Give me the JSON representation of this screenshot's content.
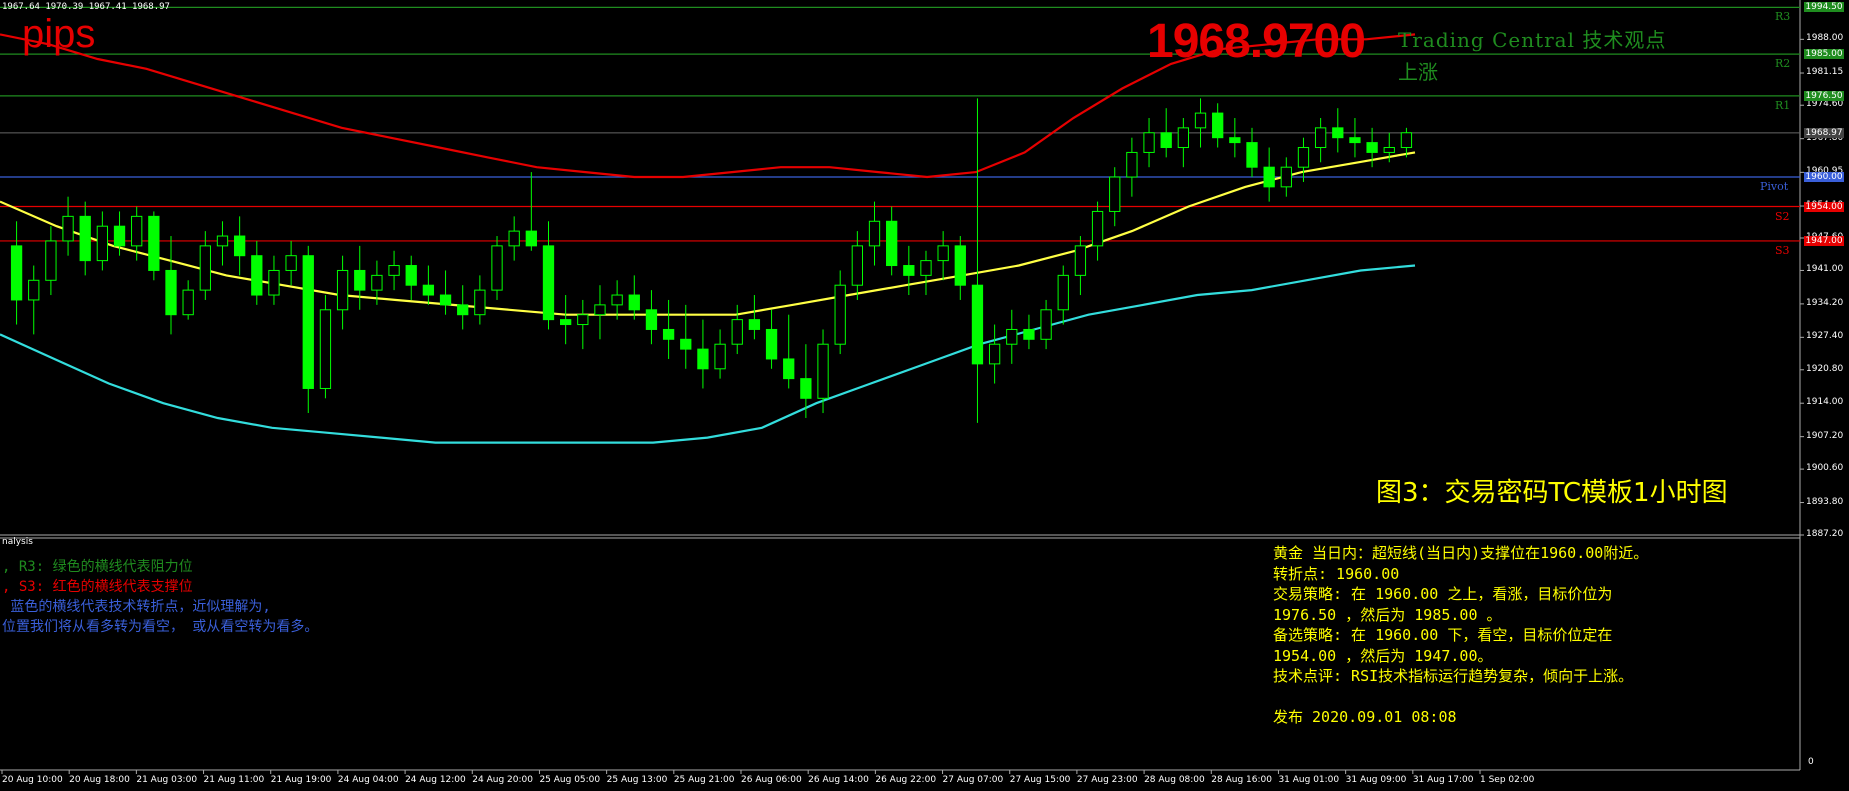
{
  "header": {
    "ohlc": "1967.64 1970.39 1967.41 1968.97",
    "watermark": "pips",
    "current_price": "1968.9700",
    "tc_title": "Trading Central 技术观点",
    "tc_direction": "上涨",
    "figure_caption": "图3：交易密码TC模板1小时图"
  },
  "levels": [
    {
      "name": "R3",
      "price": 1994.5,
      "label": "R3",
      "color": "#1f8c1f"
    },
    {
      "name": "R2",
      "price": 1985.0,
      "label": "R2",
      "color": "#1f8c1f"
    },
    {
      "name": "R1",
      "price": 1976.5,
      "label": "R1",
      "color": "#1f8c1f"
    },
    {
      "name": "Pivot",
      "price": 1960.0,
      "label": "Pivot",
      "color": "#3a5fd9"
    },
    {
      "name": "S2",
      "price": 1954.0,
      "label": "S2",
      "color": "#e60000"
    },
    {
      "name": "S3",
      "price": 1947.0,
      "label": "S3",
      "color": "#e60000"
    }
  ],
  "current_price_value": 1968.97,
  "price_axis": {
    "ticks": [
      "1988.00",
      "1981.15",
      "1974.60",
      "1967.80",
      "1960.95",
      "1954.10",
      "1947.60",
      "1941.00",
      "1934.20",
      "1927.40",
      "1920.80",
      "1914.00",
      "1907.20",
      "1900.60",
      "1893.80",
      "1887.20"
    ],
    "tags": [
      {
        "text": "1994.50",
        "color": "#1f8c1f"
      },
      {
        "text": "1985.00",
        "color": "#1f8c1f"
      },
      {
        "text": "1976.50",
        "color": "#1f8c1f"
      },
      {
        "text": "1968.97",
        "color": "#444444"
      },
      {
        "text": "1960.00",
        "color": "#3a5fd9"
      },
      {
        "text": "1954.00",
        "color": "#e60000"
      },
      {
        "text": "1947.00",
        "color": "#e60000"
      }
    ],
    "sub_zero": "0"
  },
  "time_axis": [
    "20 Aug 10:00",
    "20 Aug 18:00",
    "21 Aug 03:00",
    "21 Aug 11:00",
    "21 Aug 19:00",
    "24 Aug 04:00",
    "24 Aug 12:00",
    "24 Aug 20:00",
    "25 Aug 05:00",
    "25 Aug 13:00",
    "25 Aug 21:00",
    "26 Aug 06:00",
    "26 Aug 14:00",
    "26 Aug 22:00",
    "27 Aug 07:00",
    "27 Aug 15:00",
    "27 Aug 23:00",
    "28 Aug 08:00",
    "28 Aug 16:00",
    "31 Aug 01:00",
    "31 Aug 09:00",
    "31 Aug 17:00",
    "1 Sep 02:00"
  ],
  "subwindow": {
    "title": "nalysis",
    "legend": [
      {
        "text": ", R3: 绿色的横线代表阻力位",
        "color": "#1f8c1f"
      },
      {
        "text": ", S3: 红色的横线代表支撑位",
        "color": "#e60000"
      },
      {
        "text": " 蓝色的横线代表技术转折点，近似理解为,",
        "color": "#3a5fd9"
      },
      {
        "text": "位置我们将从看多转为看空， 或从看空转为看多。",
        "color": "#3a5fd9"
      }
    ],
    "analysis": [
      "黄金 当日内：超短线(当日内)支撑位在1960.00附近。",
      "转折点: 1960.00",
      "交易策略: 在 1960.00 之上，看涨，目标价位为",
      "1976.50 ，然后为 1985.00 。",
      "备选策略: 在 1960.00 下，看空，目标价位定在",
      "1954.00 ，然后为 1947.00。",
      "技术点评: RSI技术指标运行趋势复杂，倾向于上涨。",
      "",
      "发布 2020.09.01 08:08"
    ]
  },
  "chart_data": {
    "type": "candlestick",
    "symbol_price": 1968.97,
    "ylim": [
      1887.2,
      1996.0
    ],
    "candles": [
      [
        1946,
        1951,
        1930,
        1935
      ],
      [
        1935,
        1942,
        1928,
        1939
      ],
      [
        1939,
        1950,
        1936,
        1947
      ],
      [
        1947,
        1956,
        1944,
        1952
      ],
      [
        1952,
        1955,
        1940,
        1943
      ],
      [
        1943,
        1953,
        1941,
        1950
      ],
      [
        1950,
        1953,
        1944,
        1946
      ],
      [
        1946,
        1954,
        1943,
        1952
      ],
      [
        1952,
        1953,
        1939,
        1941
      ],
      [
        1941,
        1948,
        1928,
        1932
      ],
      [
        1932,
        1939,
        1931,
        1937
      ],
      [
        1937,
        1949,
        1935,
        1946
      ],
      [
        1946,
        1951,
        1942,
        1948
      ],
      [
        1948,
        1952,
        1940,
        1944
      ],
      [
        1944,
        1947,
        1934,
        1936
      ],
      [
        1936,
        1944,
        1934,
        1941
      ],
      [
        1941,
        1947,
        1938,
        1944
      ],
      [
        1944,
        1946,
        1912,
        1917
      ],
      [
        1917,
        1936,
        1915,
        1933
      ],
      [
        1933,
        1944,
        1929,
        1941
      ],
      [
        1941,
        1946,
        1933,
        1937
      ],
      [
        1937,
        1943,
        1934,
        1940
      ],
      [
        1940,
        1945,
        1937,
        1942
      ],
      [
        1942,
        1944,
        1935,
        1938
      ],
      [
        1938,
        1942,
        1934,
        1936
      ],
      [
        1936,
        1941,
        1932,
        1934
      ],
      [
        1934,
        1938,
        1929,
        1932
      ],
      [
        1932,
        1940,
        1930,
        1937
      ],
      [
        1937,
        1948,
        1935,
        1946
      ],
      [
        1946,
        1952,
        1943,
        1949
      ],
      [
        1949,
        1961,
        1945,
        1946
      ],
      [
        1946,
        1951,
        1929,
        1931
      ],
      [
        1931,
        1936,
        1926,
        1930
      ],
      [
        1930,
        1935,
        1925,
        1932
      ],
      [
        1932,
        1938,
        1927,
        1934
      ],
      [
        1934,
        1939,
        1931,
        1936
      ],
      [
        1936,
        1940,
        1931,
        1933
      ],
      [
        1933,
        1937,
        1926,
        1929
      ],
      [
        1929,
        1935,
        1923,
        1927
      ],
      [
        1927,
        1934,
        1921,
        1925
      ],
      [
        1925,
        1931,
        1917,
        1921
      ],
      [
        1921,
        1929,
        1919,
        1926
      ],
      [
        1926,
        1934,
        1924,
        1931
      ],
      [
        1931,
        1936,
        1927,
        1929
      ],
      [
        1929,
        1933,
        1921,
        1923
      ],
      [
        1923,
        1932,
        1917,
        1919
      ],
      [
        1919,
        1926,
        1911,
        1915
      ],
      [
        1915,
        1929,
        1912,
        1926
      ],
      [
        1926,
        1941,
        1924,
        1938
      ],
      [
        1938,
        1949,
        1935,
        1946
      ],
      [
        1946,
        1955,
        1942,
        1951
      ],
      [
        1951,
        1954,
        1940,
        1942
      ],
      [
        1942,
        1946,
        1936,
        1940
      ],
      [
        1940,
        1945,
        1936,
        1943
      ],
      [
        1943,
        1949,
        1939,
        1946
      ],
      [
        1946,
        1948,
        1935,
        1938
      ],
      [
        1938,
        1976,
        1910,
        1922
      ],
      [
        1922,
        1930,
        1918,
        1926
      ],
      [
        1926,
        1933,
        1922,
        1929
      ],
      [
        1929,
        1932,
        1925,
        1927
      ],
      [
        1927,
        1935,
        1925,
        1933
      ],
      [
        1933,
        1942,
        1930,
        1940
      ],
      [
        1940,
        1948,
        1936,
        1946
      ],
      [
        1946,
        1955,
        1943,
        1953
      ],
      [
        1953,
        1962,
        1950,
        1960
      ],
      [
        1960,
        1968,
        1956,
        1965
      ],
      [
        1965,
        1972,
        1962,
        1969
      ],
      [
        1969,
        1974,
        1964,
        1966
      ],
      [
        1966,
        1972,
        1962,
        1970
      ],
      [
        1970,
        1976,
        1966,
        1973
      ],
      [
        1973,
        1975,
        1966,
        1968
      ],
      [
        1968,
        1972,
        1964,
        1967
      ],
      [
        1967,
        1970,
        1960,
        1962
      ],
      [
        1962,
        1966,
        1955,
        1958
      ],
      [
        1958,
        1964,
        1956,
        1962
      ],
      [
        1962,
        1968,
        1959,
        1966
      ],
      [
        1966,
        1972,
        1963,
        1970
      ],
      [
        1970,
        1974,
        1965,
        1968
      ],
      [
        1968,
        1972,
        1964,
        1967
      ],
      [
        1967,
        1970,
        1962,
        1965
      ],
      [
        1965,
        1969,
        1963,
        1966
      ],
      [
        1966,
        1970,
        1964,
        1969
      ]
    ],
    "series": [
      {
        "name": "",
        "color": "#e60000",
        "values": [
          1989,
          1987,
          1984,
          1982,
          1979,
          1976,
          1973,
          1970,
          1968,
          1966,
          1964,
          1962,
          1961,
          1960,
          1960,
          1961,
          1962,
          1962,
          1961,
          1960,
          1961,
          1965,
          1972,
          1978,
          1983,
          1986,
          1987,
          1988,
          1988,
          1989
        ]
      },
      {
        "name": "",
        "color": "#ffff44",
        "values": [
          1955,
          1950,
          1946,
          1943,
          1940,
          1938,
          1936,
          1935,
          1934,
          1933,
          1932,
          1932,
          1932,
          1932,
          1934,
          1936,
          1938,
          1940,
          1942,
          1945,
          1949,
          1954,
          1958,
          1961,
          1963,
          1965
        ]
      },
      {
        "name": "",
        "color": "#33dddd",
        "values": [
          1928,
          1923,
          1918,
          1914,
          1911,
          1909,
          1908,
          1907,
          1906,
          1906,
          1906,
          1906,
          1906,
          1907,
          1909,
          1914,
          1918,
          1922,
          1926,
          1929,
          1932,
          1934,
          1936,
          1937,
          1939,
          1941,
          1942
        ]
      }
    ]
  }
}
